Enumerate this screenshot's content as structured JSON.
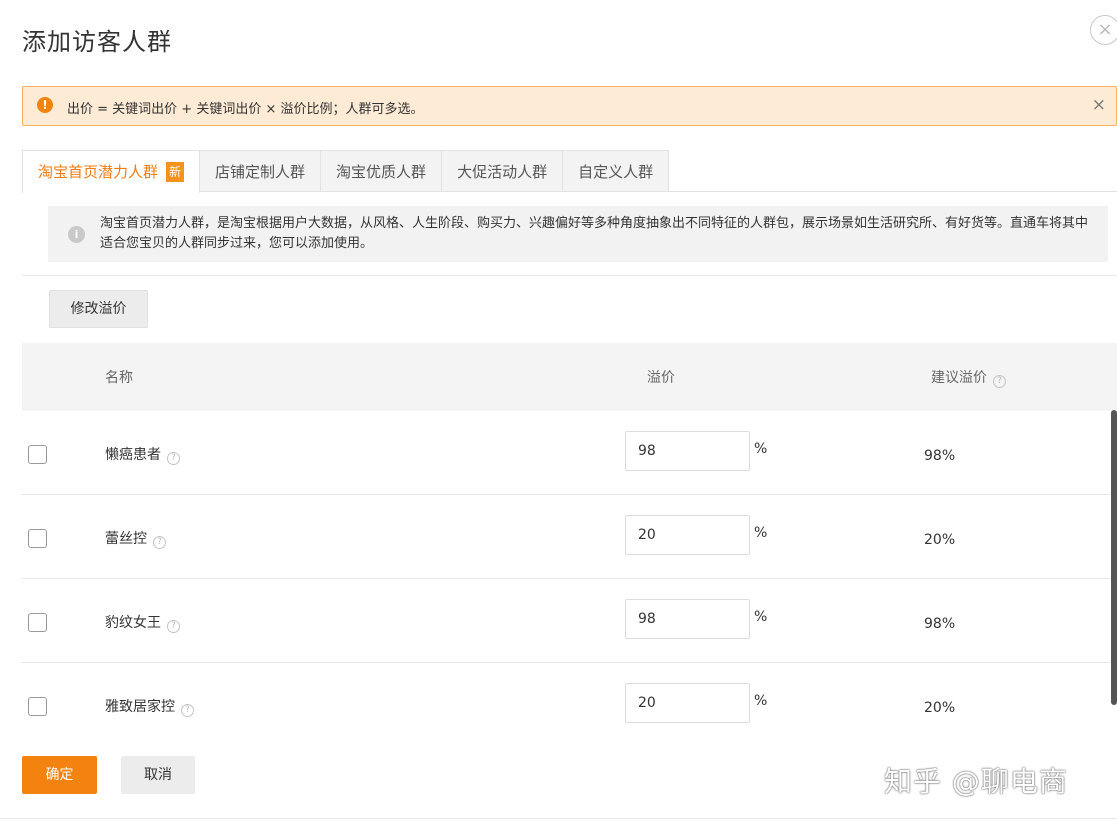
{
  "dialog": {
    "title": "添加访客人群",
    "close_glyph": "×"
  },
  "alert": {
    "icon_glyph": "!",
    "text": "出价 = 关键词出价 + 关键词出价 × 溢价比例；人群可多选。",
    "close_glyph": "×"
  },
  "tabs": [
    {
      "label": "淘宝首页潜力人群",
      "badge": "新",
      "active": true
    },
    {
      "label": "店铺定制人群",
      "active": false
    },
    {
      "label": "淘宝优质人群",
      "active": false
    },
    {
      "label": "大促活动人群",
      "active": false
    },
    {
      "label": "自定义人群",
      "active": false
    }
  ],
  "info": {
    "icon_glyph": "i",
    "text": "淘宝首页潜力人群，是淘宝根据用户大数据，从风格、人生阶段、购买力、兴趣偏好等多种角度抽象出不同特征的人群包，展示场景如生活研究所、有好货等。直通车将其中适合您宝贝的人群同步过来，您可以添加使用。"
  },
  "modify_button": "修改溢价",
  "table": {
    "columns": {
      "name": "名称",
      "premium": "溢价",
      "suggest": "建议溢价"
    },
    "help_glyph": "?",
    "unit": "%",
    "rows": [
      {
        "name": "懒癌患者",
        "premium": "98",
        "suggest": "98%"
      },
      {
        "name": "蕾丝控",
        "premium": "20",
        "suggest": "20%"
      },
      {
        "name": "豹纹女王",
        "premium": "98",
        "suggest": "98%"
      },
      {
        "name": "雅致居家控",
        "premium": "20",
        "suggest": "20%"
      }
    ]
  },
  "footer": {
    "ok": "确定",
    "cancel": "取消"
  },
  "watermark": "知乎 @聊电商",
  "colors": {
    "accent": "#f4820f",
    "alert_bg": "#fdebd6",
    "alert_border": "#f8b15e"
  }
}
